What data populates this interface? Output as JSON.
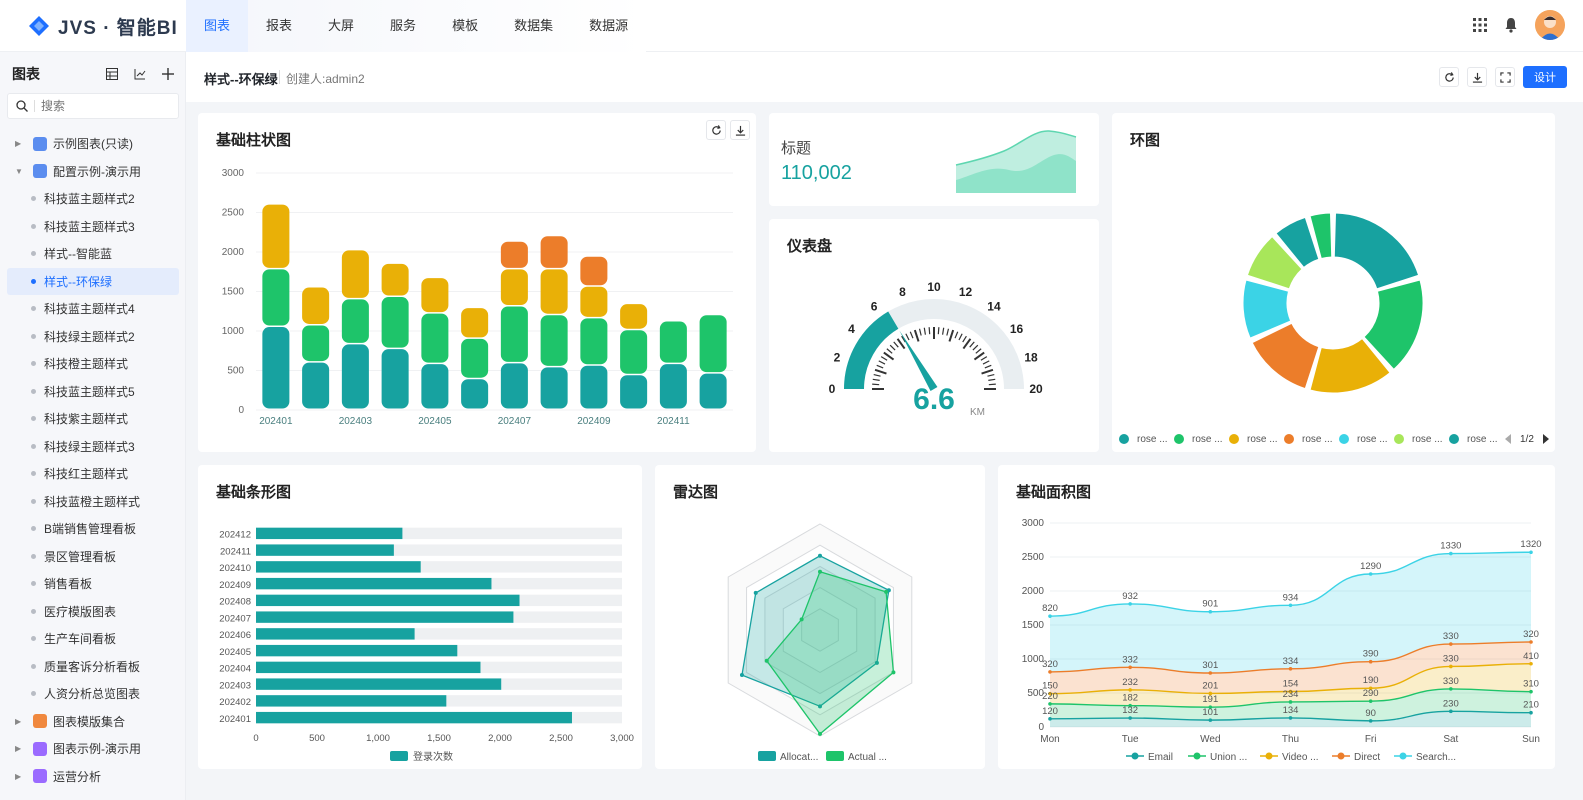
{
  "app": {
    "title": "JVS · 智能BI"
  },
  "nav": {
    "items": [
      "图表",
      "报表",
      "大屏",
      "服务",
      "模板",
      "数据集",
      "数据源"
    ],
    "active": 0
  },
  "sidebar": {
    "title": "图表",
    "search_placeholder": "搜索",
    "items": [
      {
        "label": "示例图表(只读)",
        "level": 1,
        "expand": "collapsed",
        "icon_color": "#5b8def"
      },
      {
        "label": "配置示例-演示用",
        "level": 1,
        "expand": "expanded",
        "icon_color": "#5b8def"
      },
      {
        "label": "科技蓝主题样式2",
        "level": 2
      },
      {
        "label": "科技蓝主题样式3",
        "level": 2
      },
      {
        "label": "样式--智能蓝",
        "level": 2
      },
      {
        "label": "样式--环保绿",
        "level": 2,
        "selected": true
      },
      {
        "label": "科技蓝主题样式4",
        "level": 2
      },
      {
        "label": "科技绿主题样式2",
        "level": 2
      },
      {
        "label": "科技橙主题样式",
        "level": 2
      },
      {
        "label": "科技蓝主题样式5",
        "level": 2
      },
      {
        "label": "科技紫主题样式",
        "level": 2
      },
      {
        "label": "科技绿主题样式3",
        "level": 2
      },
      {
        "label": "科技红主题样式",
        "level": 2
      },
      {
        "label": "科技蓝橙主题样式",
        "level": 2
      },
      {
        "label": "B端销售管理看板",
        "level": 2
      },
      {
        "label": "景区管理看板",
        "level": 2
      },
      {
        "label": "销售看板",
        "level": 2
      },
      {
        "label": "医疗模版图表",
        "level": 2
      },
      {
        "label": "生产车间看板",
        "level": 2
      },
      {
        "label": "质量客诉分析看板",
        "level": 2
      },
      {
        "label": "人资分析总览图表",
        "level": 2
      },
      {
        "label": "图表模版集合",
        "level": 1,
        "expand": "collapsed",
        "icon_color": "#f0883e"
      },
      {
        "label": "图表示例-演示用",
        "level": 1,
        "expand": "collapsed",
        "icon_color": "#9b6bff"
      },
      {
        "label": "运营分析",
        "level": 1,
        "expand": "collapsed",
        "icon_color": "#9b6bff"
      }
    ]
  },
  "page": {
    "name": "样式--环保绿",
    "creator": "创建人:admin2",
    "design_label": "设计"
  },
  "colors": {
    "primary": "#1e6fff",
    "teal": "#17a2a0",
    "green": "#1ec46a",
    "amber": "#e9b007",
    "orange": "#ec7d2a",
    "cyan": "#3bd3e6",
    "lime": "#a8e65a"
  },
  "chart_data": [
    {
      "id": "bar",
      "type": "bar",
      "title": "基础柱状图",
      "stacked": true,
      "categories": [
        "202401",
        "202402",
        "202403",
        "202404",
        "202405",
        "202406",
        "202407",
        "202408",
        "202409",
        "202410",
        "202411",
        "202412"
      ],
      "xtick_labels": [
        "202401",
        "",
        "202403",
        "",
        "202405",
        "",
        "202407",
        "",
        "202409",
        "",
        "202411",
        ""
      ],
      "yticks": [
        0,
        500,
        1000,
        1500,
        2000,
        2500,
        3000
      ],
      "ylim": [
        0,
        3000
      ],
      "series": [
        {
          "values": [
            1050,
            600,
            830,
            770,
            580,
            390,
            590,
            540,
            560,
            440,
            580,
            460
          ],
          "color": "#17a2a0"
        },
        {
          "values": [
            730,
            470,
            570,
            660,
            640,
            510,
            720,
            660,
            600,
            570,
            540,
            740
          ],
          "color": "#1ec46a"
        },
        {
          "values": [
            820,
            480,
            620,
            420,
            450,
            390,
            470,
            580,
            400,
            330,
            0,
            0
          ],
          "color": "#e9b007"
        },
        {
          "values": [
            0,
            0,
            0,
            0,
            0,
            0,
            350,
            420,
            380,
            0,
            0,
            0
          ],
          "color": "#ec7d2a"
        }
      ]
    },
    {
      "id": "kpi",
      "type": "area",
      "title": "标题",
      "value": "110,002"
    },
    {
      "id": "gauge",
      "type": "gauge",
      "title": "仪表盘",
      "value": 6.6,
      "unit": "KM",
      "min": 0,
      "max": 20,
      "ticks": [
        "0",
        "2",
        "4",
        "6",
        "8",
        "10",
        "12",
        "14",
        "16",
        "18",
        "20"
      ]
    },
    {
      "id": "donut",
      "type": "pie",
      "title": "环图",
      "slices": [
        {
          "name": "rose ...",
          "value": 36,
          "color": "#17a2a0"
        },
        {
          "name": "rose ...",
          "value": 32,
          "color": "#1ec46a"
        },
        {
          "name": "rose ...",
          "value": 28,
          "color": "#e9b007"
        },
        {
          "name": "rose ...",
          "value": 24,
          "color": "#ec7d2a"
        },
        {
          "name": "rose ...",
          "value": 20,
          "color": "#3bd3e6"
        },
        {
          "name": "rose ...",
          "value": 16,
          "color": "#a8e65a"
        },
        {
          "name": "rose ...",
          "value": 12,
          "color": "#17a2a0"
        },
        {
          "name": "",
          "value": 8,
          "color": "#1ec46a"
        }
      ],
      "legend_page": "1/2"
    },
    {
      "id": "hbar",
      "type": "bar",
      "orientation": "horizontal",
      "title": "基础条形图",
      "categories": [
        "202412",
        "202411",
        "202410",
        "202409",
        "202408",
        "202407",
        "202406",
        "202405",
        "202404",
        "202403",
        "202402",
        "202401"
      ],
      "values": [
        1200,
        1130,
        1350,
        1930,
        2160,
        2110,
        1300,
        1650,
        1840,
        2010,
        1560,
        2590
      ],
      "xticks": [
        "0",
        "500",
        "1,000",
        "1,500",
        "2,000",
        "2,500",
        "3,000"
      ],
      "xlim": [
        0,
        3000
      ],
      "legend": "登录次数",
      "color": "#17a2a0"
    },
    {
      "id": "radar",
      "type": "radar",
      "title": "雷达图",
      "max": 100,
      "series": [
        {
          "name": "Allocat...",
          "values": [
            70,
            75,
            62,
            72,
            85,
            70
          ],
          "color": "#17a2a0"
        },
        {
          "name": "Actual ...",
          "values": [
            55,
            72,
            80,
            98,
            58,
            20
          ],
          "color": "#1ec46a"
        }
      ]
    },
    {
      "id": "area",
      "type": "area",
      "title": "基础面积图",
      "stacked": true,
      "categories": [
        "Mon",
        "Tue",
        "Wed",
        "Thu",
        "Fri",
        "Sat",
        "Sun"
      ],
      "yticks": [
        "0",
        "500",
        "1000",
        "1500",
        "2000",
        "2500",
        "3000"
      ],
      "ylim": [
        0,
        3000
      ],
      "series": [
        {
          "name": "Email",
          "values": [
            120,
            132,
            101,
            134,
            90,
            230,
            210
          ],
          "color": "#17a2a0"
        },
        {
          "name": "Union ...",
          "values": [
            220,
            182,
            191,
            234,
            290,
            330,
            310
          ],
          "color": "#1ec46a"
        },
        {
          "name": "Video ...",
          "values": [
            150,
            232,
            201,
            154,
            190,
            330,
            410
          ],
          "color": "#e9b007"
        },
        {
          "name": "Direct",
          "values": [
            320,
            332,
            301,
            334,
            390,
            330,
            320
          ],
          "color": "#ec7d2a"
        },
        {
          "name": "Search...",
          "values": [
            820,
            932,
            901,
            934,
            1290,
            1330,
            1320
          ],
          "color": "#3bd3e6"
        }
      ]
    }
  ]
}
